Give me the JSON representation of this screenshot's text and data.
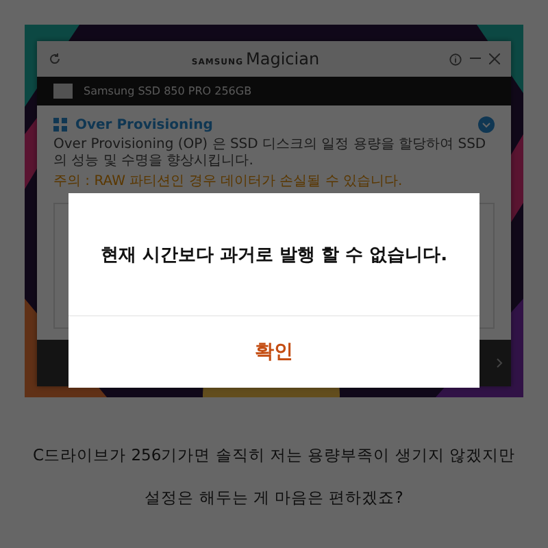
{
  "app_window": {
    "brand": "SAMSUNG",
    "title": "Magician",
    "drive": "Samsung SSD 850 PRO 256GB",
    "section_title": "Over Provisioning",
    "description": "Over Provisioning (OP) 은 SSD 디스크의 일정 용량을 할당하여 SSD의 성능 및 수명을 향상시킵니다.",
    "warning": "주의 : RAW 파티션인 경우 데이터가 손실될 수 있습니다."
  },
  "dialog": {
    "message": "현재 시간보다 과거로 발행 할 수 없습니다.",
    "button": "확인"
  },
  "caption": [
    "C드라이브가 256기가면 솔직히 저는 용량부족이 생기지 않겠지만",
    "설정은 해두는 게 마음은 편하겠죠?"
  ]
}
